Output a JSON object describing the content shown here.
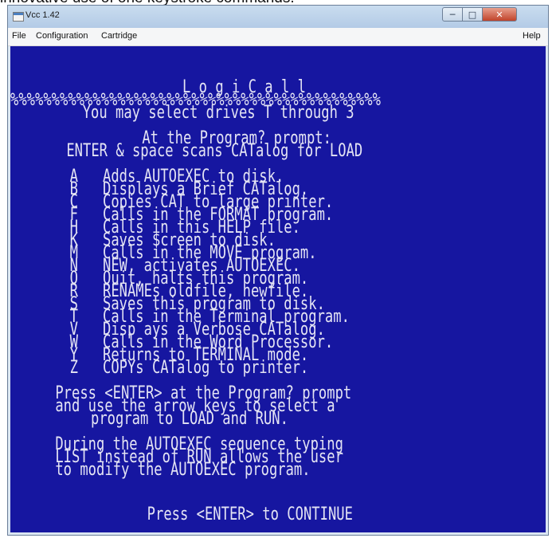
{
  "caption": "innovative use of one keystroke commands.",
  "window": {
    "title": "Vcc 1.42",
    "controls": {
      "minimize_icon": "minimize-icon",
      "maximize_icon": "maximize-icon",
      "close_icon": "close-icon"
    }
  },
  "menu": {
    "file": "File",
    "configuration": "Configuration",
    "cartridge": "Cartridge",
    "help": "Help"
  },
  "screen": {
    "lines": [
      "L o g i C a l l",
      "%%%%%%%%%%%%%%%%%%%%%%%%%%%%%%%%%%%%%%%%%%%%%",
      "  You may select drives T through 3",
      "",
      "    At the Program? prompt:",
      " ENTER & space scans CATalog for LOAD",
      "",
      "  A   Adds AUTOEXEC to disk.",
      "  B   Displays a Brief CATalog.",
      "  C   Copies CAT to large printer.",
      "  F   Calls in the FORMAT program.",
      "  H   Calls in this HELP file.",
      "  K   Saves $creen to disk.",
      "  M   Calls in the MOVE program.",
      "  N   NEW, activates AUTOEXEC.",
      "  Q   Quit, halts this program.",
      "  R   RENAMEs oldfile, newfile.",
      "  S   Saves this program to disk.",
      "  T   Calls in the Terminal program.",
      "  V   Disp ays a Verbose CATalog.",
      "  W   Calls in the Word Processor.",
      "  Y   Returns to TERMINAL mode.",
      "  Z   COPYs CATalog to printer.",
      "",
      " Press <ENTER> at the Program? prompt",
      " and use the arrow keys to select a",
      "   program to LOAD and RUN.",
      "",
      " During the AUTOEXEC sequence typing",
      " LIST instead of RUN allows the user",
      " to modify the AUTOEXEC program.",
      "",
      "     Press <ENTER> to CONTINUE"
    ]
  }
}
